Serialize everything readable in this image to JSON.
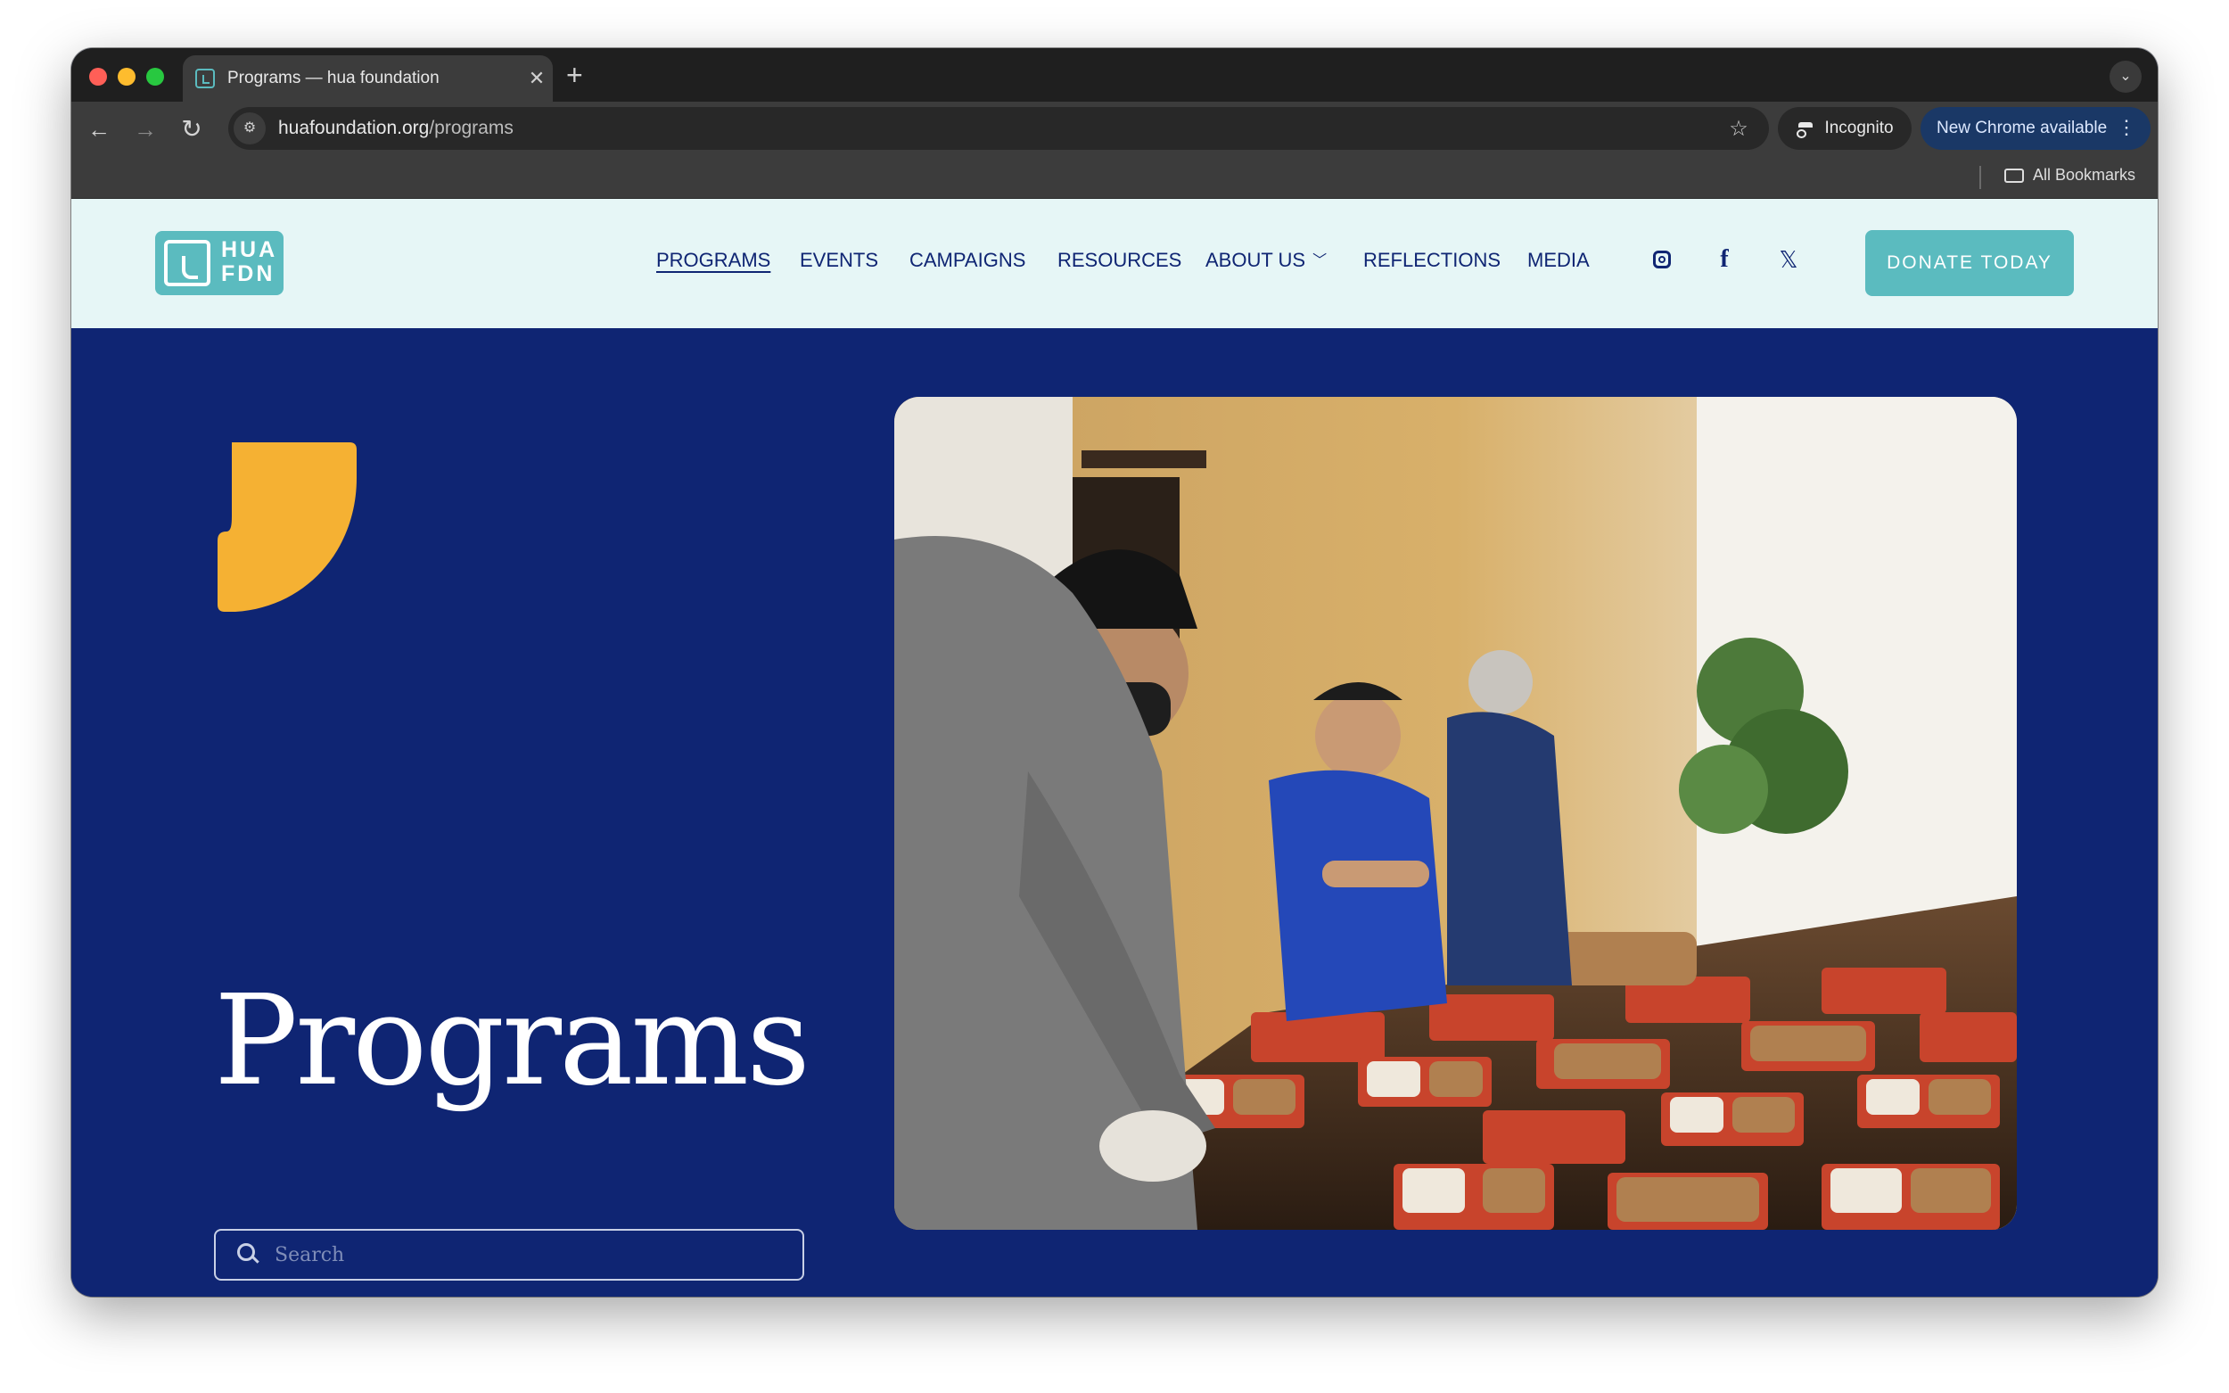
{
  "browser": {
    "tab_title": "Programs — hua foundation",
    "url_domain": "huafoundation.org",
    "url_path": "/programs",
    "incognito_label": "Incognito",
    "update_label": "New Chrome available",
    "bookmarks_label": "All Bookmarks"
  },
  "site": {
    "logo_text_line1": "HUA",
    "logo_text_line2": "FDN",
    "nav": [
      "PROGRAMS",
      "EVENTS",
      "CAMPAIGNS",
      "RESOURCES",
      "ABOUT US",
      "REFLECTIONS",
      "MEDIA"
    ],
    "donate_label": "DONATE TODAY",
    "colors": {
      "header_bg": "#e6f6f6",
      "navy": "#0f2573",
      "teal": "#5bbbbf",
      "accent_yellow": "#f5b133"
    }
  },
  "hero": {
    "title": "Programs",
    "search_placeholder": "Search",
    "photo_alt": "Volunteers in masks packing meal trays"
  },
  "icons": [
    "search-icon",
    "star-icon",
    "instagram-icon",
    "facebook-icon",
    "x-icon",
    "chevron-down-icon",
    "folder-icon"
  ]
}
